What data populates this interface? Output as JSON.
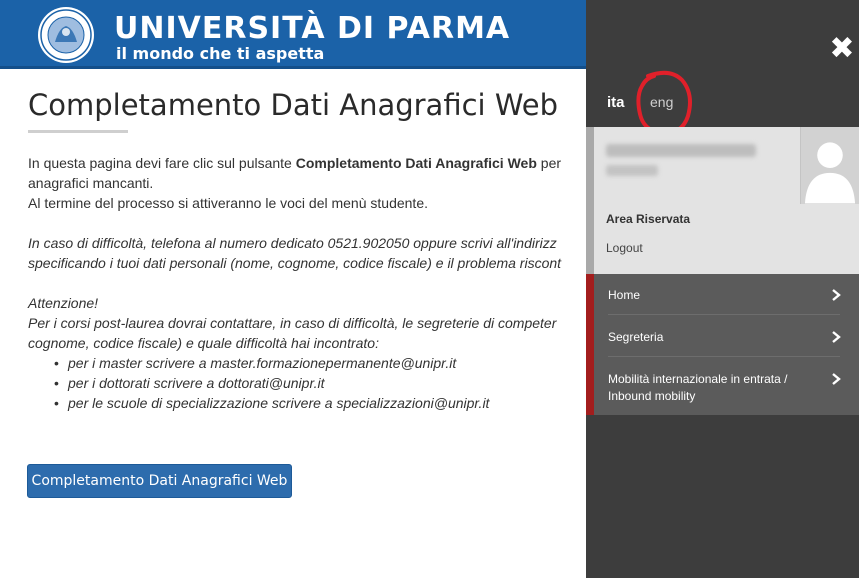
{
  "header": {
    "title": "UNIVERSITÀ DI PARMA",
    "tagline": "il mondo che ti aspetta",
    "seal_icon": "university-seal-icon"
  },
  "main": {
    "title": "Completamento Dati Anagrafici Web",
    "p1_line1_pre": "In questa pagina devi fare clic sul pulsante ",
    "p1_line1_bold": "Completamento Dati Anagrafici Web",
    "p1_line1_post": " per",
    "p1_line2": "anagrafici mancanti.",
    "p1_line3": "Al termine del processo si attiveranno le voci del menù studente.",
    "p2_line1": "In caso di difficoltà, telefona al numero dedicato 0521.902050 oppure scrivi all'indirizz",
    "p2_line2": "specificando i tuoi dati personali (nome, cognome, codice fiscale) e il problema riscont",
    "p3_line1": "Attenzione!",
    "p3_line2": "Per i corsi post-laurea dovrai contattare, in caso di difficoltà, le segreterie di competer",
    "p3_line3": "cognome, codice fiscale) e quale difficoltà hai incontrato:",
    "bullets": [
      "per i master scrivere a master.formazionepermanente@unipr.it",
      "per i dottorati scrivere a dottorati@unipr.it",
      "per le scuole di specializzazione scrivere a specializzazioni@unipr.it"
    ],
    "button_label": "Completamento Dati Anagrafici Web"
  },
  "panel": {
    "lang_active": "ita",
    "lang_other": "eng",
    "area_label": "Area Riservata",
    "logout_label": "Logout",
    "nav": [
      {
        "label_line1": "Home",
        "label_line2": ""
      },
      {
        "label_line1": "Segreteria",
        "label_line2": ""
      },
      {
        "label_line1": "Mobilità internazionale in entrata /",
        "label_line2": "Inbound mobility"
      }
    ]
  },
  "colors": {
    "header_blue": "#1b62a8",
    "panel_dark": "#3d3d3d",
    "nav_gray": "#5b5b5b",
    "accent_red": "#a31d1d",
    "button_blue": "#2d6cad"
  }
}
